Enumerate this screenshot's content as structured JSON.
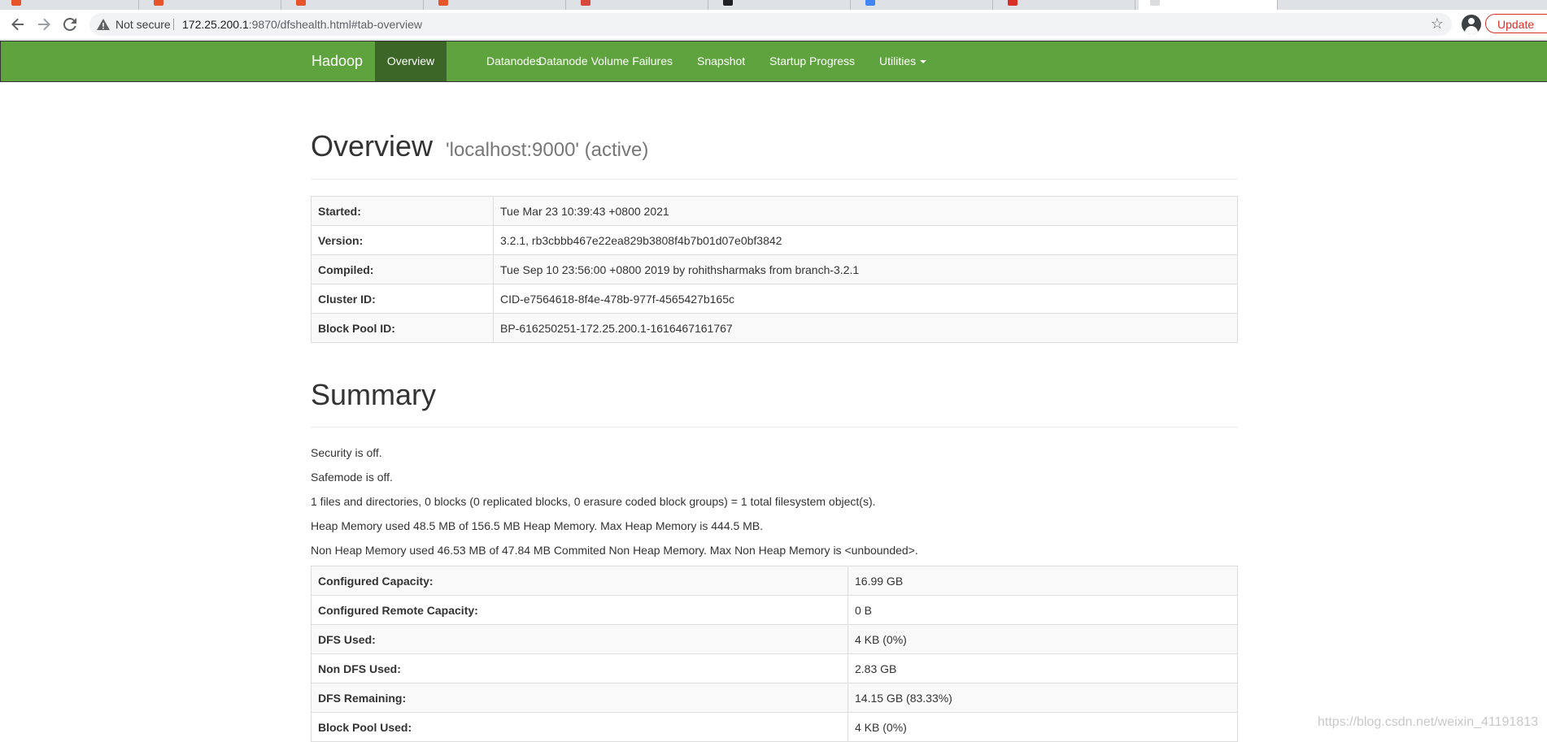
{
  "browser": {
    "not_secure": "Not secure",
    "url_host": "172.25.200.1",
    "url_rest": ":9870/dfshealth.html#tab-overview",
    "update_label": "Update"
  },
  "navbar": {
    "brand": "Hadoop",
    "items": [
      {
        "label": "Overview"
      },
      {
        "label": "Datanodes"
      },
      {
        "label": "Datanode Volume Failures"
      },
      {
        "label": "Snapshot"
      },
      {
        "label": "Startup Progress"
      },
      {
        "label": "Utilities"
      }
    ],
    "active_color": "#3b6627",
    "bar_color": "#5fa33e"
  },
  "overview": {
    "title": "Overview",
    "subtitle": "'localhost:9000' (active)",
    "rows": [
      {
        "key": "Started:",
        "value": "Tue Mar 23 10:39:43 +0800 2021"
      },
      {
        "key": "Version:",
        "value": "3.2.1, rb3cbbb467e22ea829b3808f4b7b01d07e0bf3842"
      },
      {
        "key": "Compiled:",
        "value": "Tue Sep 10 23:56:00 +0800 2019 by rohithsharmaks from branch-3.2.1"
      },
      {
        "key": "Cluster ID:",
        "value": "CID-e7564618-8f4e-478b-977f-4565427b165c"
      },
      {
        "key": "Block Pool ID:",
        "value": "BP-616250251-172.25.200.1-1616467161767"
      }
    ]
  },
  "summary": {
    "title": "Summary",
    "lines": [
      "Security is off.",
      "Safemode is off.",
      "1 files and directories, 0 blocks (0 replicated blocks, 0 erasure coded block groups) = 1 total filesystem object(s).",
      "Heap Memory used 48.5 MB of 156.5 MB Heap Memory. Max Heap Memory is 444.5 MB.",
      "Non Heap Memory used 46.53 MB of 47.84 MB Commited Non Heap Memory. Max Non Heap Memory is <unbounded>."
    ],
    "rows": [
      {
        "key": "Configured Capacity:",
        "value": "16.99 GB"
      },
      {
        "key": "Configured Remote Capacity:",
        "value": "0 B"
      },
      {
        "key": "DFS Used:",
        "value": "4 KB (0%)"
      },
      {
        "key": "Non DFS Used:",
        "value": "2.83 GB"
      },
      {
        "key": "DFS Remaining:",
        "value": "14.15 GB (83.33%)"
      },
      {
        "key": "Block Pool Used:",
        "value": "4 KB (0%)"
      }
    ]
  },
  "watermark": "https://blog.csdn.net/weixin_41191813"
}
